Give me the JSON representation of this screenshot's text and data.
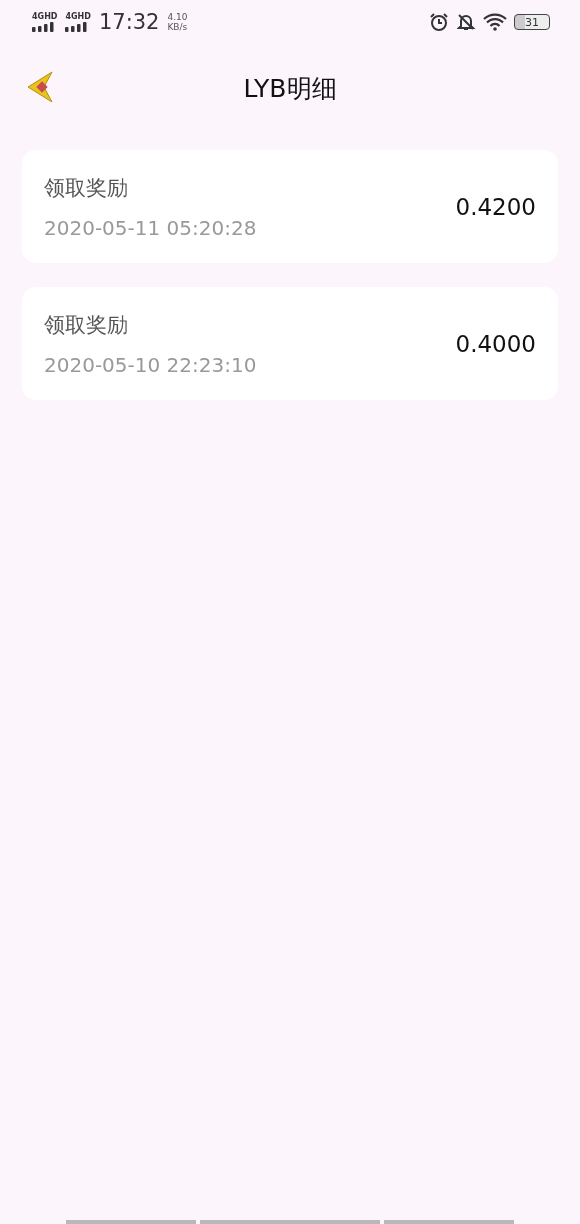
{
  "status_bar": {
    "signal_labels": [
      "4GHD",
      "4GHD"
    ],
    "time": "17:32",
    "net_speed": "4.10",
    "net_unit": "KB/s",
    "battery": "31"
  },
  "header": {
    "title": "LYB明细"
  },
  "records": [
    {
      "title": "领取奖励",
      "time": "2020-05-11 05:20:28",
      "amount": "0.4200"
    },
    {
      "title": "领取奖励",
      "time": "2020-05-10 22:23:10",
      "amount": "0.4000"
    }
  ]
}
